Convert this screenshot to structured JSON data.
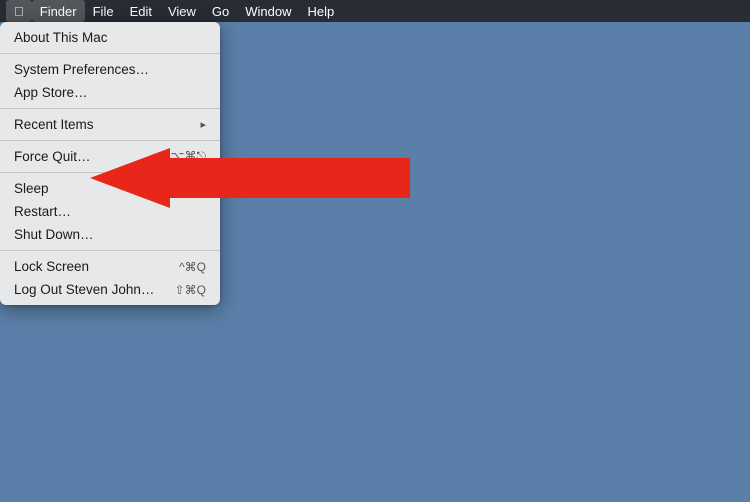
{
  "menubar": {
    "apple_symbol": "",
    "app_name": "Finder",
    "menus": [
      "File",
      "Edit",
      "View",
      "Go",
      "Window",
      "Help"
    ]
  },
  "dropdown": {
    "items": [
      {
        "id": "about-mac",
        "label": "About This Mac",
        "shortcut": "",
        "has_arrow": false,
        "separator_after": false
      },
      {
        "id": "separator-1",
        "type": "separator"
      },
      {
        "id": "system-prefs",
        "label": "System Preferences…",
        "shortcut": "",
        "has_arrow": false,
        "separator_after": false
      },
      {
        "id": "app-store",
        "label": "App Store…",
        "shortcut": "",
        "has_arrow": false,
        "separator_after": false
      },
      {
        "id": "separator-2",
        "type": "separator"
      },
      {
        "id": "recent-items",
        "label": "Recent Items",
        "shortcut": "",
        "has_arrow": true,
        "separator_after": false
      },
      {
        "id": "separator-3",
        "type": "separator"
      },
      {
        "id": "force-quit",
        "label": "Force Quit…",
        "shortcut": "⌥⌘⎋",
        "has_arrow": false,
        "separator_after": false
      },
      {
        "id": "separator-4",
        "type": "separator"
      },
      {
        "id": "sleep",
        "label": "Sleep",
        "shortcut": "",
        "has_arrow": false,
        "separator_after": false
      },
      {
        "id": "restart",
        "label": "Restart…",
        "shortcut": "",
        "has_arrow": false,
        "separator_after": false
      },
      {
        "id": "shut-down",
        "label": "Shut Down…",
        "shortcut": "",
        "has_arrow": false,
        "separator_after": false
      },
      {
        "id": "separator-5",
        "type": "separator"
      },
      {
        "id": "lock-screen",
        "label": "Lock Screen",
        "shortcut": "^⌘Q",
        "has_arrow": false,
        "separator_after": false
      },
      {
        "id": "log-out",
        "label": "Log Out Steven John…",
        "shortcut": "⇧⌘Q",
        "has_arrow": false,
        "separator_after": false
      }
    ]
  }
}
